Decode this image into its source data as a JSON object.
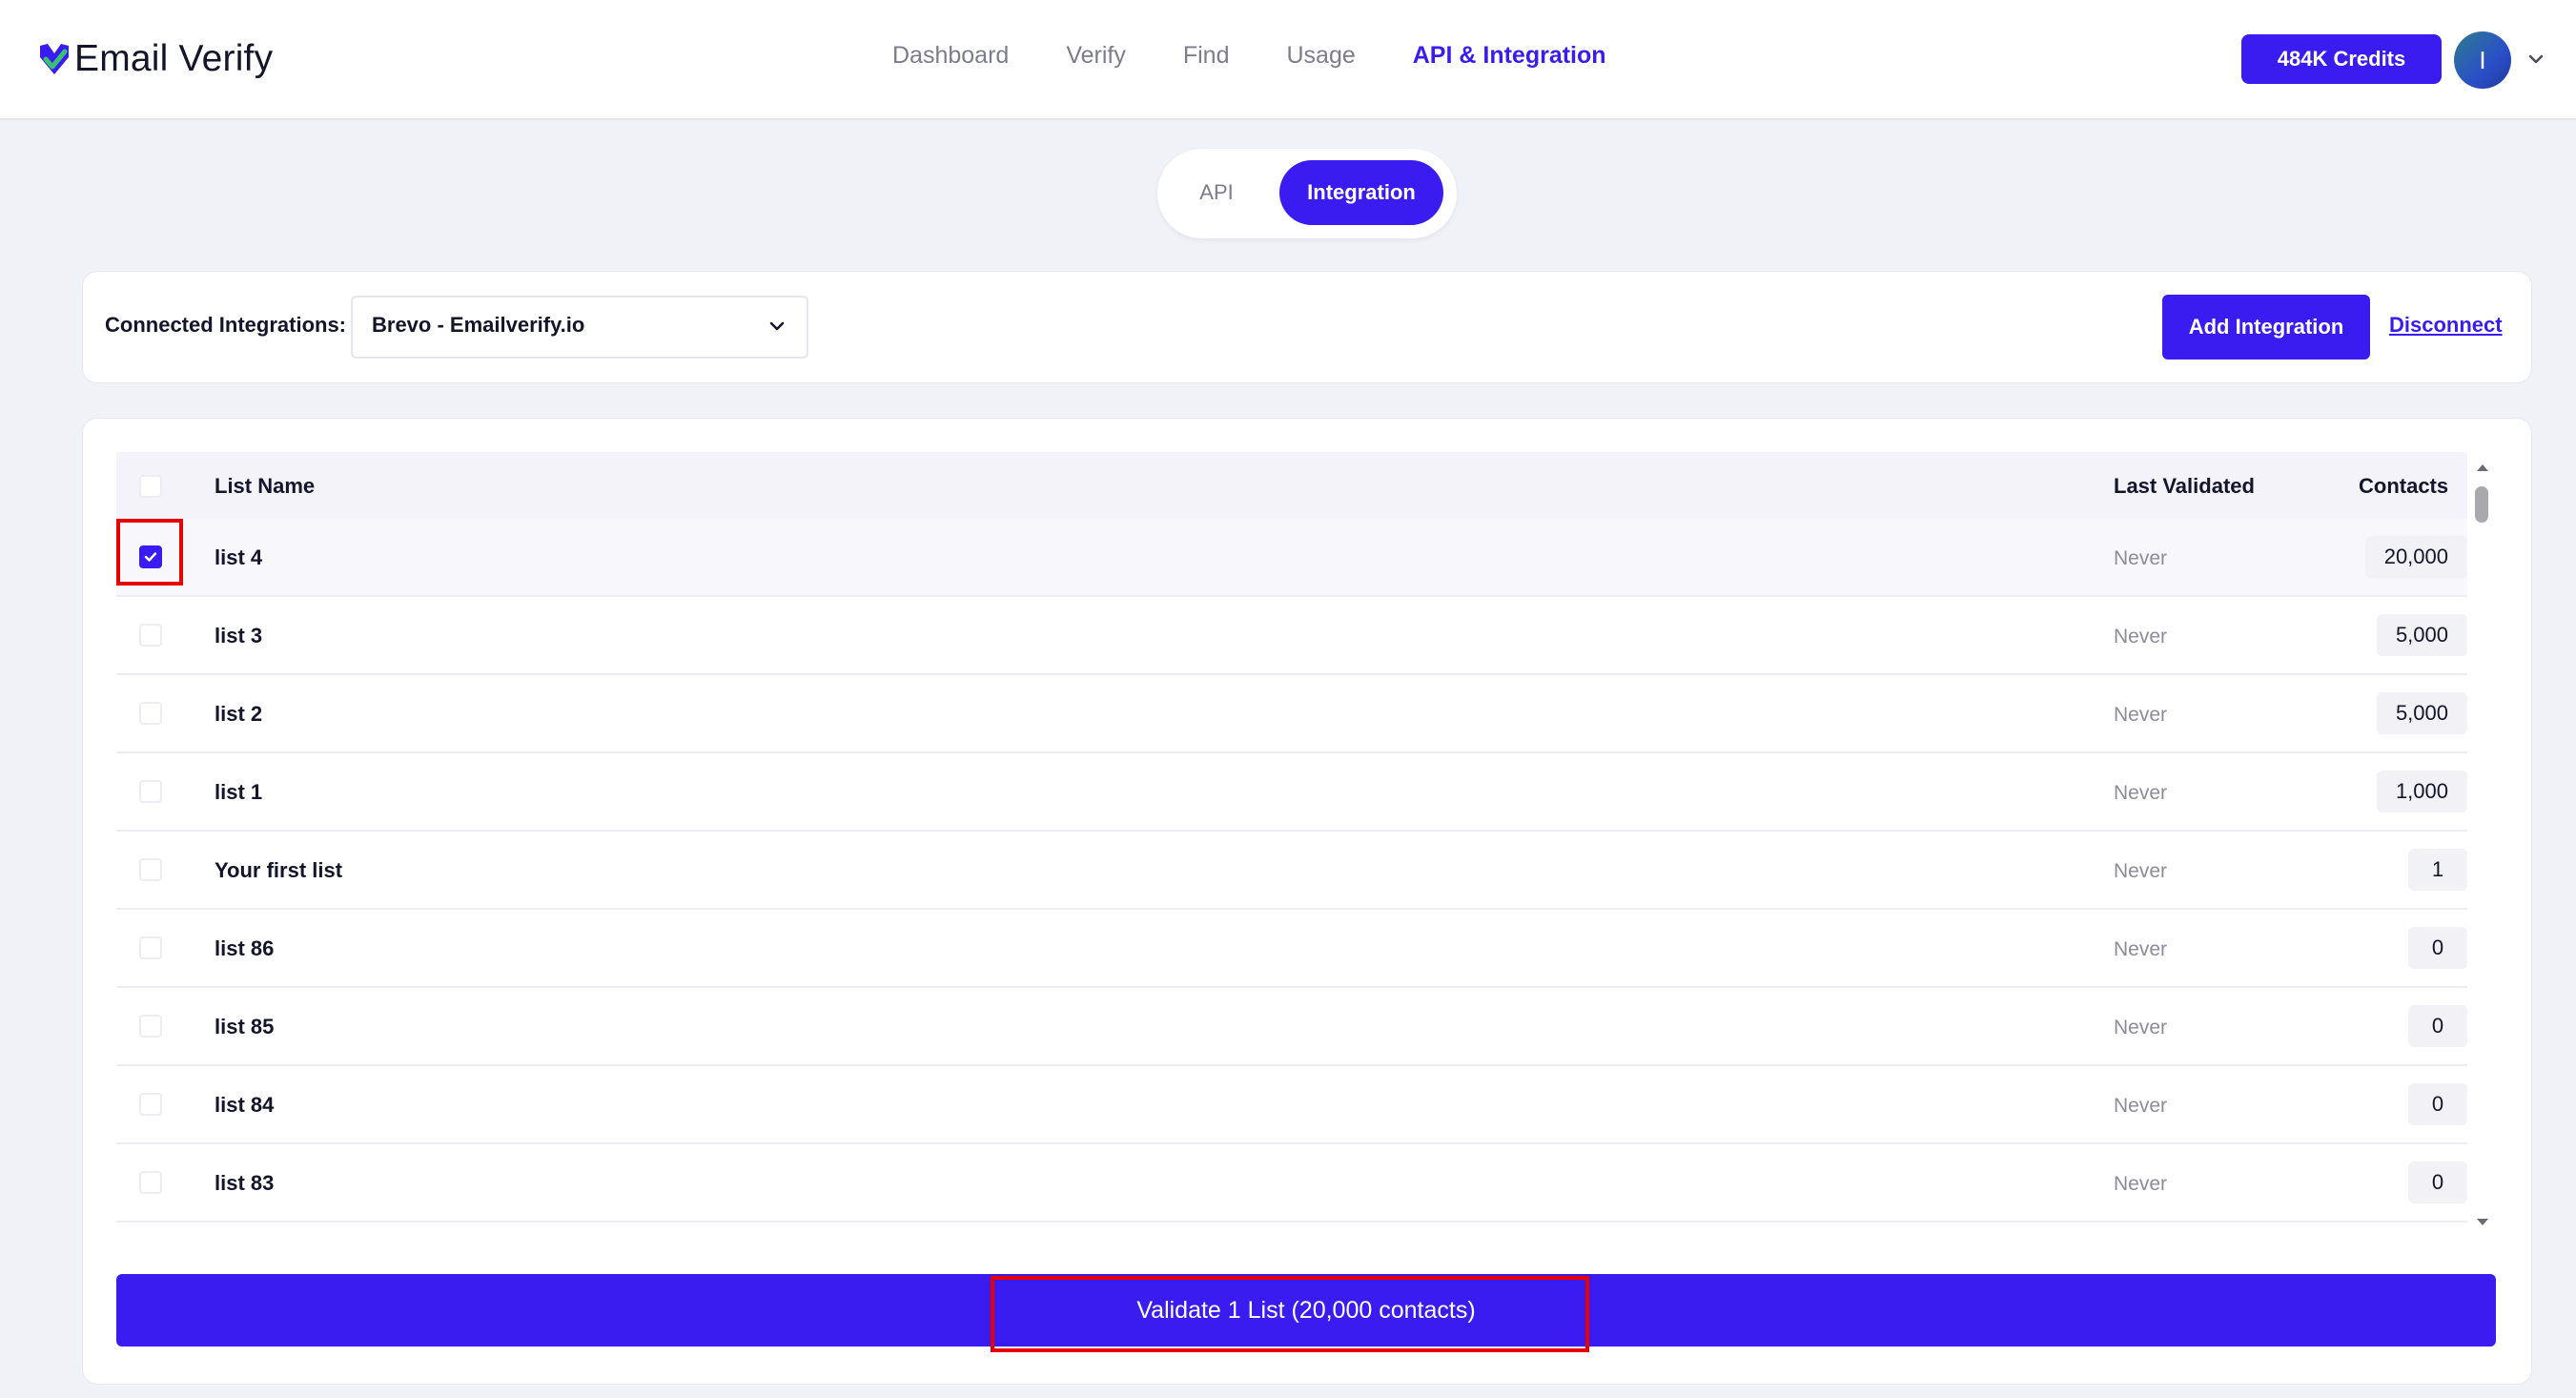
{
  "app": {
    "logo_text": "Email Verify",
    "logo_icon": "verify-check-logo"
  },
  "nav": {
    "items": [
      {
        "label": "Dashboard"
      },
      {
        "label": "Verify"
      },
      {
        "label": "Find"
      },
      {
        "label": "Usage"
      },
      {
        "label": "API & Integration",
        "active": true
      }
    ]
  },
  "header": {
    "credits_label": "484K Credits",
    "avatar_initial": "I"
  },
  "tabs": {
    "api_label": "API",
    "integration_label": "Integration",
    "active": "Integration"
  },
  "integration": {
    "label": "Connected Integrations:",
    "selected": "Brevo - Emailverify.io",
    "add_label": "Add Integration",
    "disconnect_label": "Disconnect"
  },
  "table": {
    "headers": {
      "name": "List Name",
      "last_validated": "Last Validated",
      "contacts": "Contacts"
    },
    "rows": [
      {
        "name": "list 4",
        "last": "Never",
        "contacts": "20,000",
        "checked": true
      },
      {
        "name": "list 3",
        "last": "Never",
        "contacts": "5,000",
        "checked": false
      },
      {
        "name": "list 2",
        "last": "Never",
        "contacts": "5,000",
        "checked": false
      },
      {
        "name": "list 1",
        "last": "Never",
        "contacts": "1,000",
        "checked": false
      },
      {
        "name": "Your first list",
        "last": "Never",
        "contacts": "1",
        "checked": false
      },
      {
        "name": "list 86",
        "last": "Never",
        "contacts": "0",
        "checked": false
      },
      {
        "name": "list 85",
        "last": "Never",
        "contacts": "0",
        "checked": false
      },
      {
        "name": "list 84",
        "last": "Never",
        "contacts": "0",
        "checked": false
      },
      {
        "name": "list 83",
        "last": "Never",
        "contacts": "0",
        "checked": false
      }
    ]
  },
  "validate": {
    "label": "Validate 1 List (20,000 contacts)"
  },
  "colors": {
    "accent": "#3a1cf0",
    "highlight": "#e60000",
    "background": "#f1f1f8"
  }
}
